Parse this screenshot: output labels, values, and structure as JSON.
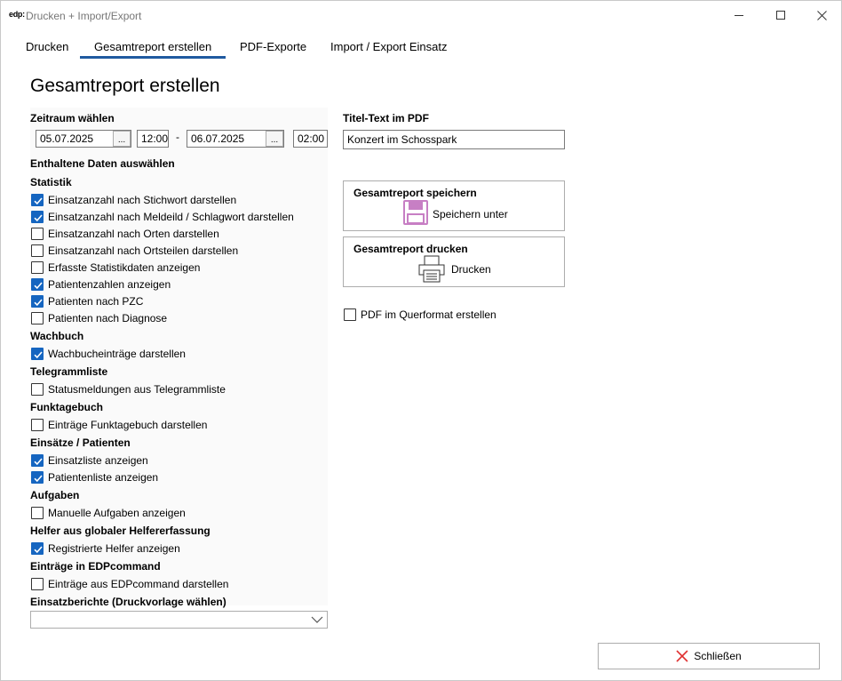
{
  "window": {
    "logo": "edp:",
    "title": "Drucken + Import/Export"
  },
  "tabs": [
    {
      "label": "Drucken"
    },
    {
      "label": "Gesamtreport erstellen"
    },
    {
      "label": "PDF-Exporte"
    },
    {
      "label": "Import / Export Einsatz"
    }
  ],
  "page_title": "Gesamtreport erstellen",
  "zeitraum": {
    "label": "Zeitraum wählen",
    "from_date": "05.07.2025",
    "from_time": "12:00",
    "separator": "-",
    "to_date": "06.07.2025",
    "to_time": "02:00",
    "picker_label": "..."
  },
  "daten_label": "Enthaltene Daten auswählen",
  "sections": {
    "statistik": {
      "title": "Statistik",
      "items": [
        {
          "label": "Einsatzanzahl nach Stichwort darstellen",
          "checked": true
        },
        {
          "label": "Einsatzanzahl nach Meldeild / Schlagwort darstellen",
          "checked": true
        },
        {
          "label": "Einsatzanzahl nach Orten darstellen",
          "checked": false
        },
        {
          "label": "Einsatzanzahl nach Ortsteilen darstellen",
          "checked": false
        },
        {
          "label": "Erfasste Statistikdaten anzeigen",
          "checked": false
        },
        {
          "label": "Patientenzahlen anzeigen",
          "checked": true
        },
        {
          "label": "Patienten nach PZC",
          "checked": true
        },
        {
          "label": "Patienten nach Diagnose",
          "checked": false
        }
      ]
    },
    "wachbuch": {
      "title": "Wachbuch",
      "items": [
        {
          "label": "Wachbucheinträge darstellen",
          "checked": true
        }
      ]
    },
    "telegramm": {
      "title": "Telegrammliste",
      "items": [
        {
          "label": "Statusmeldungen aus Telegrammliste",
          "checked": false
        }
      ]
    },
    "funk": {
      "title": "Funktagebuch",
      "items": [
        {
          "label": "Einträge Funktagebuch darstellen",
          "checked": false
        }
      ]
    },
    "einsaetze": {
      "title": "Einsätze / Patienten",
      "items": [
        {
          "label": "Einsatzliste anzeigen",
          "checked": true
        },
        {
          "label": "Patientenliste anzeigen",
          "checked": true
        }
      ]
    },
    "aufgaben": {
      "title": "Aufgaben",
      "items": [
        {
          "label": "Manuelle Aufgaben anzeigen",
          "checked": false
        }
      ]
    },
    "helfer": {
      "title": "Helfer aus globaler Helfererfassung",
      "items": [
        {
          "label": "Registrierte Helfer anzeigen",
          "checked": true
        }
      ]
    },
    "edp": {
      "title": "Einträge in EDPcommand",
      "items": [
        {
          "label": "Einträge aus EDPcommand darstellen",
          "checked": false
        }
      ]
    }
  },
  "einsatzberichte": {
    "label": "Einsatzberichte (Druckvorlage wählen)",
    "value": ""
  },
  "titel": {
    "label": "Titel-Text im PDF",
    "value": "Konzert im Schosspark"
  },
  "save_box": {
    "title": "Gesamtreport speichern",
    "button_label": "Speichern unter",
    "icon": "floppy-disk-icon",
    "icon_color": "#c77fc4"
  },
  "print_box": {
    "title": "Gesamtreport drucken",
    "button_label": "Drucken",
    "icon": "printer-icon"
  },
  "querformat": {
    "label": "PDF im Querformat erstellen",
    "checked": false
  },
  "close_button": {
    "label": "Schließen",
    "icon_color": "#e03030"
  },
  "accent_color": "#1565c0"
}
